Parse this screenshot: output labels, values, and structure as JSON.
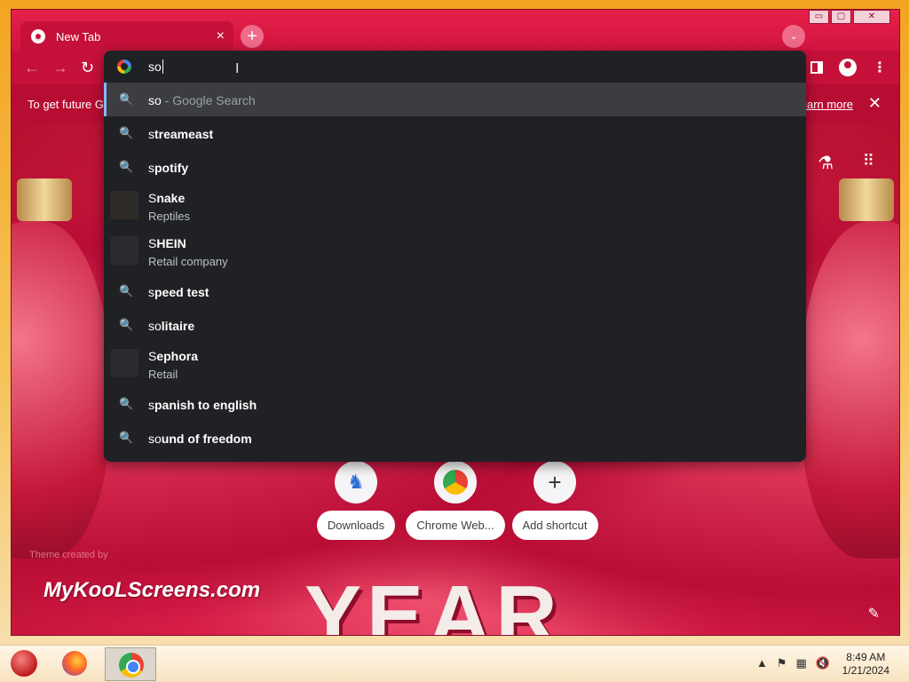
{
  "browser": {
    "tab_title": "New Tab",
    "tab_close": "×",
    "new_tab": "+",
    "tab_search": "⌄",
    "window_controls": {
      "minimize": "▭",
      "maximize": "▢",
      "close": "✕"
    }
  },
  "toolbar": {
    "back": "←",
    "forward": "→",
    "reload": "↻",
    "menu": "⋮"
  },
  "infobar": {
    "text": "To get future G",
    "link": "earn more",
    "close": "✕"
  },
  "omnibox": {
    "typed_text": "so",
    "suggestions": [
      {
        "typed": "so",
        "rest": "",
        "desc": " - Google Search",
        "sub": ""
      },
      {
        "typed": "s",
        "rest": "treameast",
        "desc": "",
        "sub": ""
      },
      {
        "typed": "s",
        "rest": "potify",
        "desc": "",
        "sub": ""
      },
      {
        "typed": "S",
        "rest": "nake",
        "desc": "",
        "sub": "Reptiles"
      },
      {
        "typed": "S",
        "rest": "HEIN",
        "desc": "",
        "sub": "Retail company"
      },
      {
        "typed": "s",
        "rest": "peed test",
        "desc": "",
        "sub": ""
      },
      {
        "typed": "so",
        "rest": "litaire",
        "desc": "",
        "sub": ""
      },
      {
        "typed": "S",
        "rest": "ephora",
        "desc": "",
        "sub": "Retail"
      },
      {
        "typed": "s",
        "rest": "panish to english",
        "desc": "",
        "sub": ""
      },
      {
        "typed": "so",
        "rest": "und of freedom",
        "desc": "",
        "sub": ""
      }
    ]
  },
  "shortcuts": [
    {
      "label": "Downloads",
      "icon": "godzilla-icon"
    },
    {
      "label": "Chrome Web...",
      "icon": "chrome-webstore-icon"
    },
    {
      "label": "Add shortcut",
      "icon": "plus-icon"
    }
  ],
  "ntp": {
    "watermark": "MyKooLScreens.com",
    "watermark_small": "Theme created by",
    "year_art": "YEAR",
    "edit": "✎"
  },
  "taskbar": {
    "time": "8:49 AM",
    "date": "1/21/2024"
  },
  "colors": {
    "accent": "#c51139",
    "omnibox_bg": "#202124",
    "selected_row": "#3c3d41",
    "focus_bar": "#8ab4f8"
  }
}
